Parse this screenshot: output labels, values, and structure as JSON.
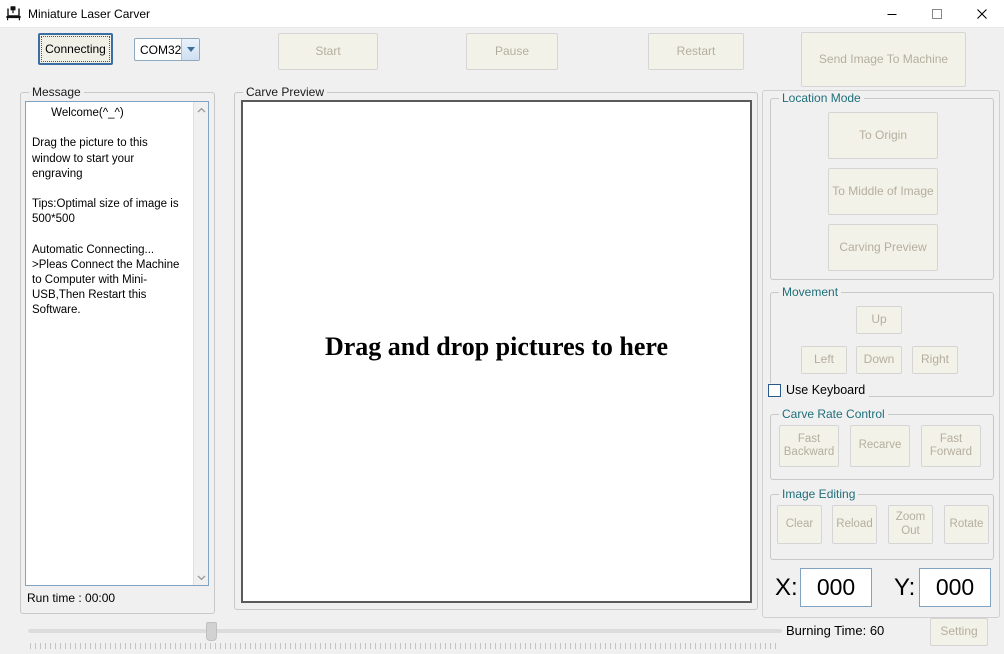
{
  "window": {
    "title": "Miniature Laser Carver",
    "icon": "laser-carver-icon",
    "minimize_label": "—",
    "maximize_label": "□",
    "close_label": "✕"
  },
  "toolbar": {
    "connect_button": "Connecting",
    "port_select": {
      "value": "COM32",
      "icon": "chevron-down-icon"
    },
    "start_button": "Start",
    "pause_button": "Pause",
    "restart_button": "Restart",
    "send_image_button": "Send Image To Machine"
  },
  "message_panel": {
    "group_label": "Message",
    "text": "      Welcome(^_^)\n\nDrag the picture to this\nwindow to start your\nengraving\n\nTips:Optimal size of image is\n500*500\n\nAutomatic Connecting...\n>Pleas Connect the Machine\nto Computer with Mini-\nUSB,Then Restart this\nSoftware.",
    "scroll_up_icon": "˄",
    "scroll_down_icon": "˅",
    "run_time_label": "Run time :  00:00"
  },
  "preview_panel": {
    "group_label": "Carve Preview",
    "drop_hint": "Drag and drop pictures to here"
  },
  "location_mode": {
    "group_label": "Location Mode",
    "buttons": [
      {
        "label": "To Origin"
      },
      {
        "label": "To Middle of Image"
      },
      {
        "label": "Carving Preview"
      }
    ]
  },
  "movement": {
    "group_label": "Movement",
    "up_button": "Up",
    "left_button": "Left",
    "down_button": "Down",
    "right_button": "Right",
    "use_keyboard_label": "Use Keyboard",
    "use_keyboard_checked": false
  },
  "carve_rate_control": {
    "group_label": "Carve Rate Control",
    "buttons": [
      {
        "label": "Fast\nBackward"
      },
      {
        "label": "Recarve"
      },
      {
        "label": "Fast\nForward"
      }
    ]
  },
  "image_editing": {
    "group_label": "Image Editing",
    "buttons": [
      {
        "label": "Clear"
      },
      {
        "label": "Reload"
      },
      {
        "label": "Zoom\nOut"
      },
      {
        "label": "Rotate"
      }
    ]
  },
  "coordinates": {
    "x_label": "X:",
    "x_value": "000",
    "y_label": "Y:",
    "y_value": "000"
  },
  "bottom_bar": {
    "slider_value_percent": 24,
    "burning_time_label": "Burning Time: 60",
    "setting_button": "Setting"
  },
  "colors": {
    "window_bg": "#f0f0f0",
    "button_face": "#f3f2e9",
    "button_border": "#d5d5d5",
    "button_text_disabled": "#b5ae9e",
    "group_label_teal": "#1f6f7a",
    "group_label_dark": "#1a1a1a",
    "focus_border": "#3c6ea5",
    "field_border": "#7fa3c0",
    "preview_border": "#5a5a5a"
  }
}
